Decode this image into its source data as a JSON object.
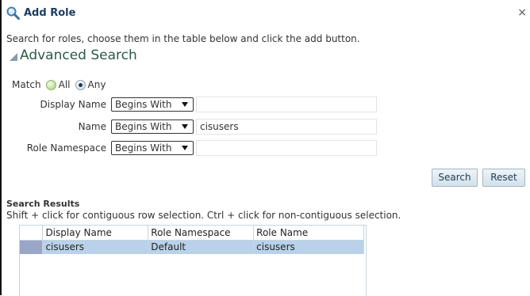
{
  "dialog": {
    "title": "Add Role",
    "close_label": "×"
  },
  "instructions": "Search for roles, choose them in the table below and click the add button.",
  "advanced_search": {
    "title": "Advanced Search",
    "match": {
      "label": "Match",
      "options": [
        "All",
        "Any"
      ],
      "selected": "Any"
    },
    "fields": [
      {
        "label": "Display Name",
        "operator": "Begins With",
        "value": ""
      },
      {
        "label": "Name",
        "operator": "Begins With",
        "value": "cisusers"
      },
      {
        "label": "Role Namespace",
        "operator": "Begins With",
        "value": ""
      }
    ],
    "search_label": "Search",
    "reset_label": "Reset"
  },
  "results": {
    "title": "Search Results",
    "hint": "Shift + click for contiguous row selection. Ctrl + click for non-contiguous selection.",
    "columns": [
      "Display Name",
      "Role Namespace",
      "Role Name"
    ],
    "rows": [
      {
        "display_name": "cisusers",
        "role_namespace": "Default",
        "role_name": "cisusers",
        "selected": true
      }
    ]
  },
  "colors": {
    "title_text": "#1c3d5e",
    "advanced_title": "#2b5b47",
    "selected_row": "#b9d2ea",
    "selected_marker": "#9aa6c6"
  },
  "icons": {
    "title_icon": "magnifier-icon",
    "close_icon": "close-icon",
    "disclosure_icon": "disclosure-expanded-icon",
    "select_arrow": "dropdown-arrow-icon"
  }
}
